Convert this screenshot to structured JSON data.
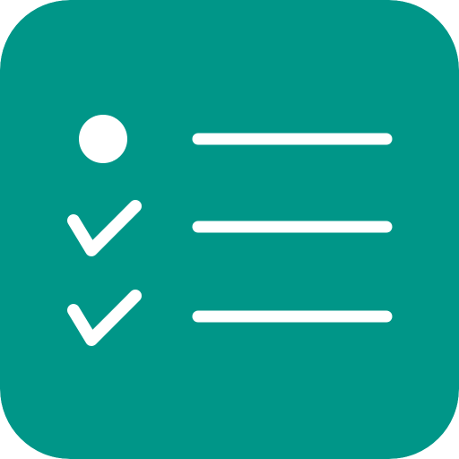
{
  "app_icon": {
    "name": "checklist-app-icon",
    "background_color": "#009688",
    "foreground_color": "#ffffff",
    "rows": [
      {
        "marker": "bullet-dot-icon",
        "state": "pending"
      },
      {
        "marker": "checkmark-icon",
        "state": "done"
      },
      {
        "marker": "checkmark-icon",
        "state": "done"
      }
    ]
  }
}
